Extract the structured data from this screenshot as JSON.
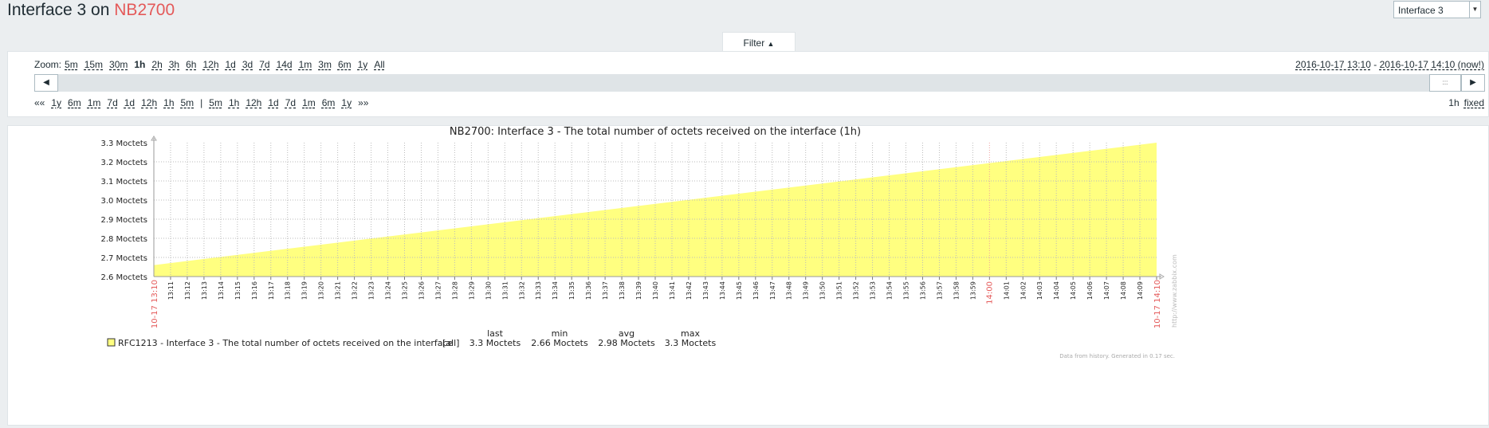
{
  "header": {
    "title_prefix": "Interface 3 on ",
    "host": "NB2700",
    "selector_value": "Interface 3"
  },
  "filter": {
    "tab_label": "Filter",
    "tab_arrow": "▲",
    "zoom_label": "Zoom:",
    "zoom_options": [
      "5m",
      "15m",
      "30m",
      "1h",
      "2h",
      "3h",
      "6h",
      "12h",
      "1d",
      "3d",
      "7d",
      "14d",
      "1m",
      "3m",
      "6m",
      "1y",
      "All"
    ],
    "zoom_current": "1h",
    "date_from": "2016-10-17 13:10",
    "date_sep": " - ",
    "date_to": "2016-10-17 14:10 (now!)",
    "nav_back_all": "««",
    "nav_back": [
      "1y",
      "6m",
      "1m",
      "7d",
      "1d",
      "12h",
      "1h",
      "5m"
    ],
    "nav_sep": "|",
    "nav_forward": [
      "5m",
      "1h",
      "12h",
      "1d",
      "7d",
      "1m",
      "6m",
      "1y"
    ],
    "nav_forward_all": "»»",
    "period_label": "1h",
    "mode_label": "fixed",
    "scroll_left_icon": "◀",
    "scroll_right_icon": "▶",
    "thumb_glyph": ":::"
  },
  "chart_data": {
    "type": "area",
    "title": "NB2700: Interface 3 - The total number of octets received on the interface (1h)",
    "y_unit": "Moctets",
    "y_ticks": [
      "3.3 Moctets",
      "3.2 Moctets",
      "3.1 Moctets",
      "3.0 Moctets",
      "2.9 Moctets",
      "2.8 Moctets",
      "2.7 Moctets",
      "2.6 Moctets"
    ],
    "ylim": [
      2.6,
      3.3
    ],
    "x_start_label": "10-17 13:10",
    "x_end_label": "10-17 14:10",
    "x_tick_labels": [
      "13:11",
      "13:12",
      "13:13",
      "13:14",
      "13:15",
      "13:16",
      "13:17",
      "13:18",
      "13:19",
      "13:20",
      "13:21",
      "13:22",
      "13:23",
      "13:24",
      "13:25",
      "13:26",
      "13:27",
      "13:28",
      "13:29",
      "13:30",
      "13:31",
      "13:32",
      "13:33",
      "13:34",
      "13:35",
      "13:36",
      "13:37",
      "13:38",
      "13:39",
      "13:40",
      "13:41",
      "13:42",
      "13:43",
      "13:44",
      "13:45",
      "13:46",
      "13:47",
      "13:48",
      "13:49",
      "13:50",
      "13:51",
      "13:52",
      "13:53",
      "13:54",
      "13:55",
      "13:56",
      "13:57",
      "13:58",
      "13:59",
      "14:00",
      "14:01",
      "14:02",
      "14:03",
      "14:04",
      "14:05",
      "14:06",
      "14:07",
      "14:08",
      "14:09",
      "14:10"
    ],
    "highlight_tick": "14:00",
    "series": [
      {
        "name": "RFC1213 - Interface 3 - The total number of octets received on the interface",
        "color": "#ffff80",
        "x": [
          "13:10",
          "14:10"
        ],
        "values": [
          2.66,
          3.3
        ]
      }
    ],
    "grid": true,
    "legend": {
      "function": "[all]",
      "headers": [
        "last",
        "min",
        "avg",
        "max"
      ],
      "values": [
        "3.3 Moctets",
        "2.66 Moctets",
        "2.98 Moctets",
        "3.3 Moctets"
      ]
    },
    "watermark": "http://www.zabbix.com",
    "footer": "Data from history. Generated in 0.17 sec."
  },
  "colors": {
    "accent_red": "#e45959",
    "area_fill": "#ffff80",
    "grid": "#cccccc"
  }
}
